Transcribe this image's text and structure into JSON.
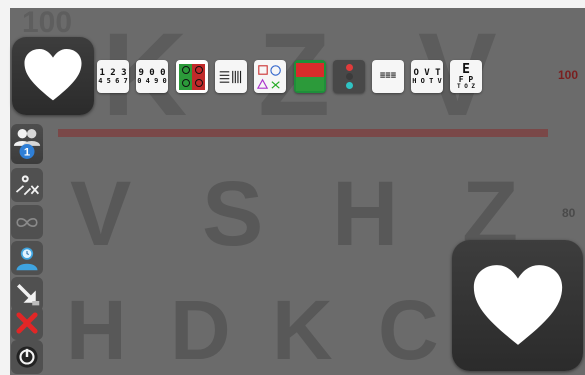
{
  "chart": {
    "row1_letters": [
      "K",
      "Z",
      "V"
    ],
    "row2_letters": [
      "V",
      "S",
      "H",
      "Z"
    ],
    "row3_letters": [
      "H",
      "D",
      "K",
      "C"
    ],
    "scale_top_left": "100",
    "scale_row1": "100",
    "scale_row2": "80"
  },
  "toolbar": {
    "numbers_label_top": "1 2 3",
    "numbers_label_bottom": "4 5 6 7",
    "symbols_label_top": "9 0 0",
    "symbols_label_bottom": "0 4 9 0",
    "letters_label_top": "O V T",
    "letters_label_bottom": "H O T V",
    "snellen_top": "E",
    "snellen_mid": "F P",
    "snellen_bottom": "T O Z"
  },
  "colors": {
    "background": "#6b6b6b",
    "heart": "#ffffff",
    "accent_red": "#8a4848",
    "scale_red": "#7a1f1f",
    "patient_blue": "#2f7fd6"
  },
  "icons": [
    "heart-icon",
    "patients-icon",
    "settings-tools-icon",
    "infinity-icon",
    "user-clock-icon",
    "shrink-arrow-icon",
    "close-icon",
    "power-icon"
  ]
}
